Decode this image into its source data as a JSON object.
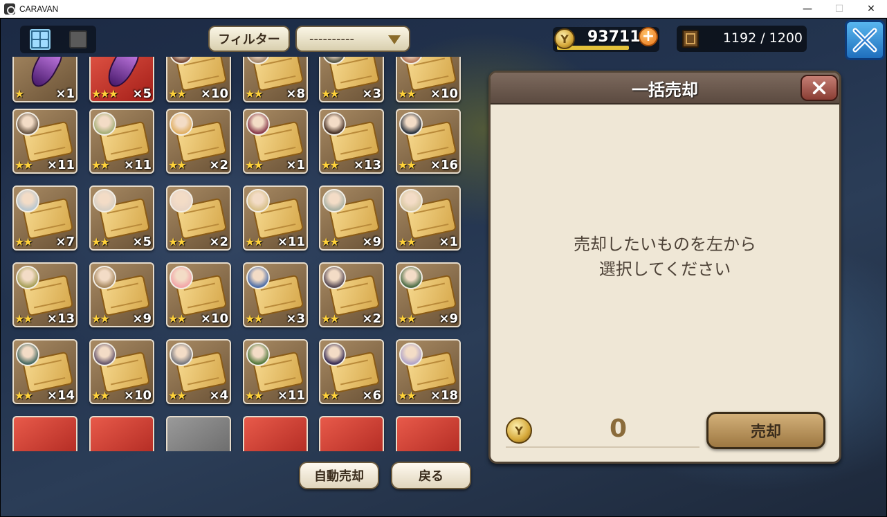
{
  "window": {
    "title": "CARAVAN",
    "minimize": "—",
    "maximize": "☐",
    "close": "✕"
  },
  "toolbar": {
    "filter_label": "フィルター",
    "select_value": "----------",
    "gold": "93711",
    "inventory_count": "1192 / 1200"
  },
  "icons": {
    "view_grid": "grid-view-icon",
    "view_list": "list-view-icon",
    "gold": "coin-icon",
    "add_gold": "plus-icon",
    "inventory": "storage-box-icon",
    "close": "close-icon"
  },
  "items": [
    {
      "type": "crystal",
      "rarity": "normal",
      "stars": "★",
      "qty": "×1",
      "face": null
    },
    {
      "type": "crystal",
      "rarity": "red",
      "stars": "★★★",
      "qty": "×5",
      "face": null
    },
    {
      "type": "scroll",
      "rarity": "normal",
      "stars": "★★",
      "qty": "×10",
      "face": "#7a4d3b"
    },
    {
      "type": "scroll",
      "rarity": "normal",
      "stars": "★★",
      "qty": "×8",
      "face": "#a88b70"
    },
    {
      "type": "scroll",
      "rarity": "normal",
      "stars": "★★",
      "qty": "×3",
      "face": "#5b5b4a"
    },
    {
      "type": "scroll",
      "rarity": "normal",
      "stars": "★★",
      "qty": "×10",
      "face": "#b67a5c"
    },
    {
      "type": "scroll",
      "rarity": "normal",
      "stars": "★★",
      "qty": "×11",
      "face": "#6b5846"
    },
    {
      "type": "scroll",
      "rarity": "normal",
      "stars": "★★",
      "qty": "×11",
      "face": "#a8b07a"
    },
    {
      "type": "scroll",
      "rarity": "normal",
      "stars": "★★",
      "qty": "×2",
      "face": "#e0b065"
    },
    {
      "type": "scroll",
      "rarity": "normal",
      "stars": "★★",
      "qty": "×1",
      "face": "#8a3d4d"
    },
    {
      "type": "scroll",
      "rarity": "normal",
      "stars": "★★",
      "qty": "×13",
      "face": "#4a3428"
    },
    {
      "type": "scroll",
      "rarity": "normal",
      "stars": "★★",
      "qty": "×16",
      "face": "#2c3540"
    },
    {
      "type": "scroll",
      "rarity": "normal",
      "stars": "★★",
      "qty": "×7",
      "face": "#b9c7cf"
    },
    {
      "type": "scroll",
      "rarity": "normal",
      "stars": "★★",
      "qty": "×5",
      "face": "#d8d0c4"
    },
    {
      "type": "scroll",
      "rarity": "normal",
      "stars": "★★",
      "qty": "×2",
      "face": "#e9d5c5"
    },
    {
      "type": "scroll",
      "rarity": "normal",
      "stars": "★★",
      "qty": "×11",
      "face": "#d8c08a"
    },
    {
      "type": "scroll",
      "rarity": "normal",
      "stars": "★★",
      "qty": "×9",
      "face": "#a9b1a4"
    },
    {
      "type": "scroll",
      "rarity": "normal",
      "stars": "★★",
      "qty": "×1",
      "face": "#d9c9a4"
    },
    {
      "type": "scroll",
      "rarity": "normal",
      "stars": "★★",
      "qty": "×13",
      "face": "#a8a05a"
    },
    {
      "type": "scroll",
      "rarity": "normal",
      "stars": "★★",
      "qty": "×9",
      "face": "#a88a62"
    },
    {
      "type": "scroll",
      "rarity": "normal",
      "stars": "★★",
      "qty": "×10",
      "face": "#f2a6a8"
    },
    {
      "type": "scroll",
      "rarity": "normal",
      "stars": "★★",
      "qty": "×3",
      "face": "#4f6fa8"
    },
    {
      "type": "scroll",
      "rarity": "normal",
      "stars": "★★",
      "qty": "×2",
      "face": "#5a4c55"
    },
    {
      "type": "scroll",
      "rarity": "normal",
      "stars": "★★",
      "qty": "×9",
      "face": "#4f6f48"
    },
    {
      "type": "scroll",
      "rarity": "normal",
      "stars": "★★",
      "qty": "×14",
      "face": "#4a6b62"
    },
    {
      "type": "scroll",
      "rarity": "normal",
      "stars": "★★",
      "qty": "×10",
      "face": "#6a5a6e"
    },
    {
      "type": "scroll",
      "rarity": "normal",
      "stars": "★★",
      "qty": "×4",
      "face": "#7a7a80"
    },
    {
      "type": "scroll",
      "rarity": "normal",
      "stars": "★★",
      "qty": "×11",
      "face": "#567a3e"
    },
    {
      "type": "scroll",
      "rarity": "normal",
      "stars": "★★",
      "qty": "×6",
      "face": "#3a2f55"
    },
    {
      "type": "scroll",
      "rarity": "normal",
      "stars": "★★",
      "qty": "×18",
      "face": "#b3a6c8"
    },
    {
      "type": "partial",
      "rarity": "red",
      "stars": "",
      "qty": "",
      "face": null
    },
    {
      "type": "partial",
      "rarity": "red",
      "stars": "",
      "qty": "",
      "face": null
    },
    {
      "type": "partial",
      "rarity": "gray",
      "stars": "",
      "qty": "",
      "face": null
    },
    {
      "type": "partial",
      "rarity": "red",
      "stars": "",
      "qty": "",
      "face": null
    },
    {
      "type": "partial",
      "rarity": "red",
      "stars": "",
      "qty": "",
      "face": null
    },
    {
      "type": "partial",
      "rarity": "red",
      "stars": "",
      "qty": "",
      "face": null
    }
  ],
  "bottom": {
    "auto_sell_label": "自動売却",
    "back_label": "戻る"
  },
  "sell_panel": {
    "title": "一括売却",
    "message_line1": "売却したいものを左から",
    "message_line2": "選択してください",
    "total_price": "0",
    "sell_label": "売却"
  }
}
